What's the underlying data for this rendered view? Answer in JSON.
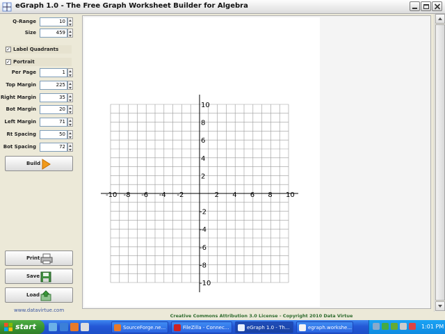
{
  "window": {
    "title": "eGraph 1.0 - The Free Graph Worksheet Builder for Algebra"
  },
  "form": {
    "fields": [
      {
        "label": "Q-Range",
        "value": "10"
      },
      {
        "label": "Size",
        "value": "459"
      },
      {
        "label": "Per Page",
        "value": "1"
      },
      {
        "label": "Top Margin",
        "value": "225"
      },
      {
        "label": "Right Margin",
        "value": "35"
      },
      {
        "label": "Bot Margin",
        "value": "20"
      },
      {
        "label": "Left Margin",
        "value": "71"
      },
      {
        "label": "Rt Spacing",
        "value": "50"
      },
      {
        "label": "Bot Spacing",
        "value": "72"
      }
    ],
    "label_quadrants": {
      "label": "Label Quadrants",
      "checked": true
    },
    "portrait": {
      "label": "Portrait",
      "checked": true
    }
  },
  "buttons": {
    "build": "Build",
    "print": "Print",
    "save": "Save",
    "load": "Load"
  },
  "website": "www.datavirtue.com",
  "graph": {
    "x_labels": [
      "-10",
      "-8",
      "-6",
      "-4",
      "-2",
      "2",
      "4",
      "6",
      "8",
      "10"
    ],
    "y_labels": [
      "10",
      "8",
      "6",
      "4",
      "2",
      "-2",
      "-4",
      "-6",
      "-8",
      "-10"
    ]
  },
  "license": "Creative Commons Attribution 3.0 License - Copyright 2010 Data Virtue",
  "taskbar": {
    "start": "start",
    "tasks": [
      "SourceForge.ne...",
      "FileZilla - Connec...",
      "eGraph 1.0 - Th...",
      "egraph.workshe..."
    ],
    "clock": "1:01 PM"
  },
  "colors": {
    "taskbar": "#2458d6",
    "start": "#3a9532",
    "license_text": "#2e6b2e",
    "link": "#3a55a0"
  }
}
